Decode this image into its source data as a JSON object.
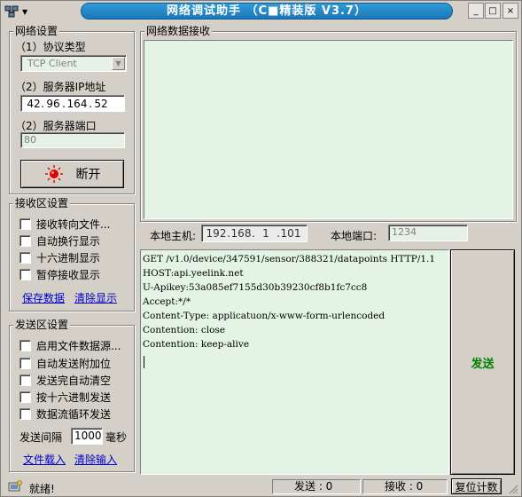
{
  "window": {
    "title": "网络调试助手 （C■精装版 V3.7）",
    "controls": {
      "minimize": "_",
      "maximize": "□",
      "close": "×"
    }
  },
  "net_settings": {
    "title": "网络设置",
    "protocol_label": "（1）协议类型",
    "protocol_value": "TCP Client",
    "server_ip_label": "（2）服务器IP地址",
    "server_ip": [
      "42",
      "96",
      "164",
      "52"
    ],
    "server_port_label": "（2）服务器端口",
    "server_port": "80",
    "connect_button": "断开"
  },
  "recv_settings": {
    "title": "接收区设置",
    "options": [
      "接收转向文件...",
      "自动换行显示",
      "十六进制显示",
      "暂停接收显示"
    ],
    "save_link": "保存数据",
    "clear_link": "清除显示"
  },
  "send_settings": {
    "title": "发送区设置",
    "options": [
      "启用文件数据源...",
      "自动发送附加位",
      "发送完自动清空",
      "按十六进制发送",
      "数据流循环发送"
    ],
    "interval_label": "发送间隔",
    "interval_value": "1000",
    "interval_unit": "毫秒",
    "load_link": "文件载入",
    "clear_link": "清除输入"
  },
  "recv_area": {
    "title": "网络数据接收"
  },
  "local": {
    "host_label": "本地主机:",
    "host_ip": [
      "192",
      "168",
      "1",
      "101"
    ],
    "port_label": "本地端口:",
    "port_value": "1234"
  },
  "send_text": [
    "GET /v1.0/device/347591/sensor/388321/datapoints HTTP/1.1",
    "HOST:api.yeelink.net",
    "U-Apikey:53a085ef7155d30b39230cf8b1fc7cc8",
    "Accept:*/*",
    "Content-Type: applicatuon/x-www-form-urlencoded",
    "Contention: close",
    "Contention: keep-alive"
  ],
  "send_button": "发送",
  "status": {
    "text": "就绪!",
    "sent_label": "发送 : 0",
    "recv_label": "接收 : 0",
    "reset_button": "复位计数"
  },
  "colors": {
    "title_bar": "#1c76b8",
    "area_bg": "#e4f4e4",
    "send_button_text": "#008000",
    "link": "#0000cc",
    "indicator": "#e00000"
  }
}
